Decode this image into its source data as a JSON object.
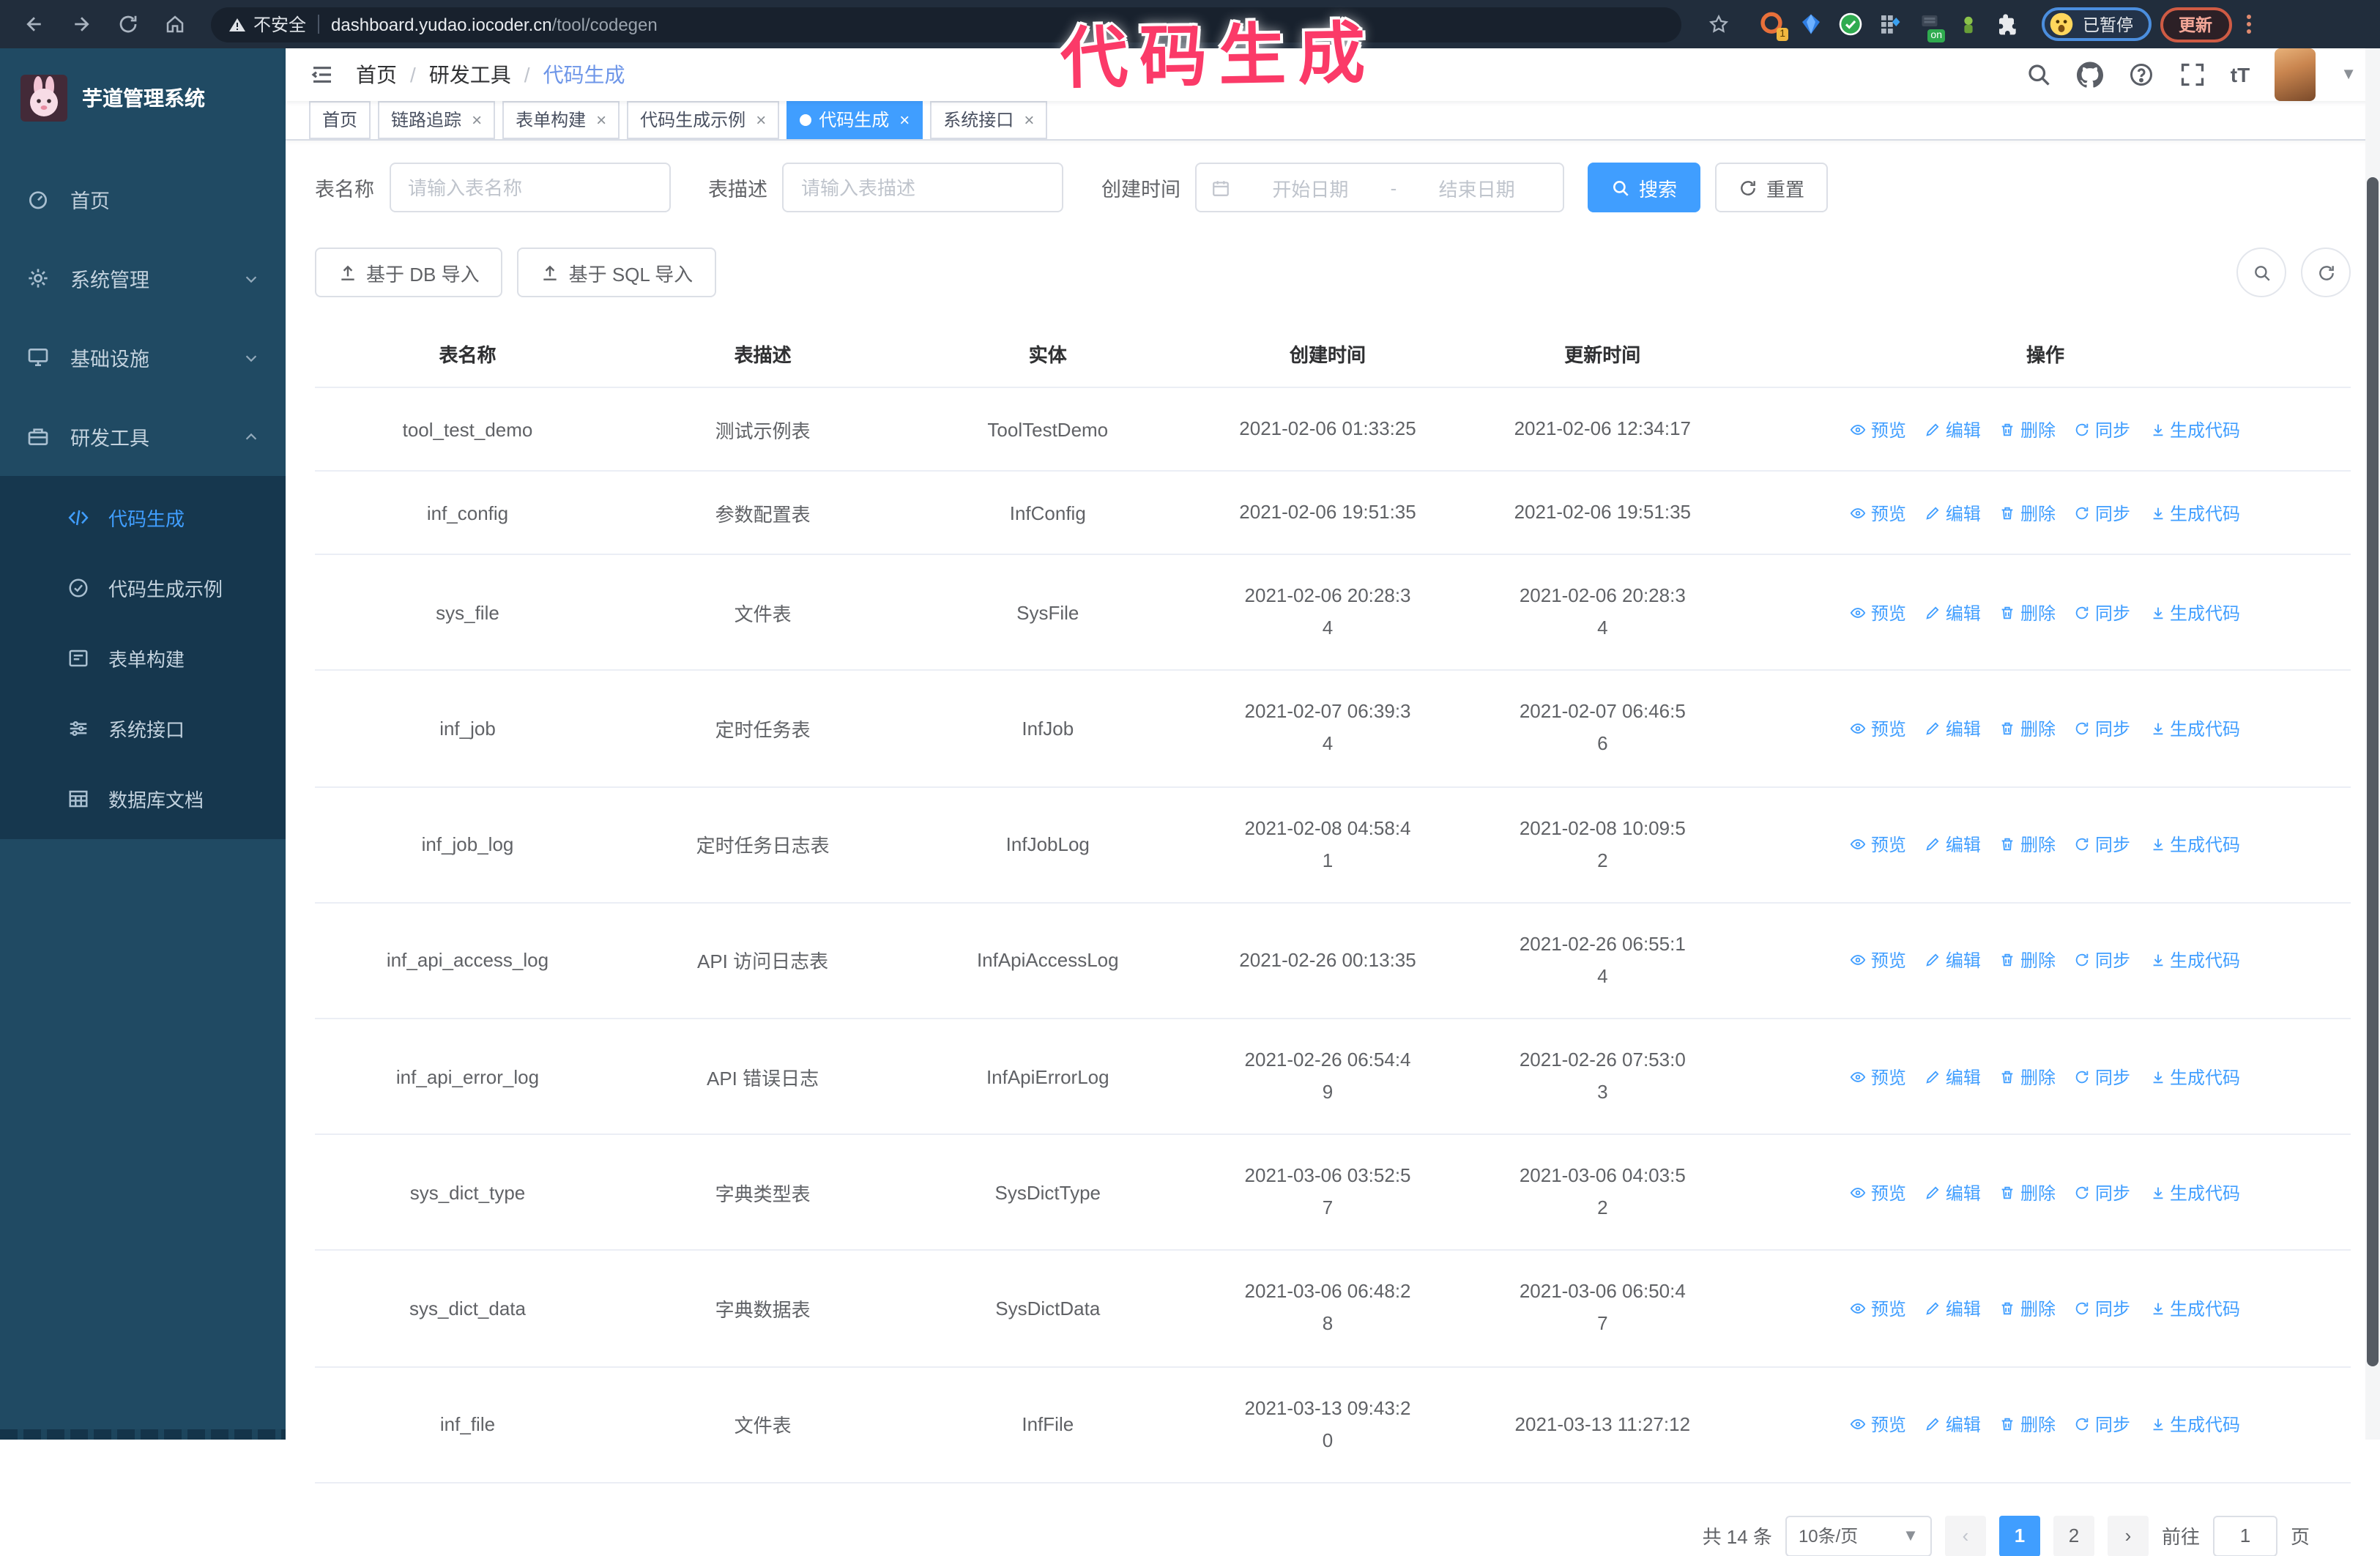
{
  "overlay": {
    "annotation": "代码生成",
    "color": "#fb3a68"
  },
  "browser": {
    "security_label": "不安全",
    "url_host": "dashboard.yudao.iocoder.cn",
    "url_path": "/tool/codegen",
    "paused_badge": "已暂停",
    "update_button": "更新",
    "extensions": [
      "orange-circle-extension",
      "blue-gem-extension",
      "green-check-extension",
      "grid-extension",
      "on-badge-extension",
      "green-bot-extension",
      "puzzle-extensions-menu"
    ]
  },
  "sidebar": {
    "title": "芋道管理系统",
    "items": [
      {
        "label": "首页"
      },
      {
        "label": "系统管理",
        "chevron": "down"
      },
      {
        "label": "基础设施",
        "chevron": "down"
      },
      {
        "label": "研发工具",
        "chevron": "up",
        "expanded": true,
        "children": [
          {
            "label": "代码生成",
            "active": true
          },
          {
            "label": "代码生成示例"
          },
          {
            "label": "表单构建"
          },
          {
            "label": "系统接口"
          },
          {
            "label": "数据库文档"
          }
        ]
      }
    ]
  },
  "header": {
    "breadcrumb": [
      "首页",
      "研发工具",
      "代码生成"
    ]
  },
  "tabs": [
    {
      "label": "首页",
      "closable": false,
      "active": false
    },
    {
      "label": "链路追踪",
      "closable": true,
      "active": false
    },
    {
      "label": "表单构建",
      "closable": true,
      "active": false
    },
    {
      "label": "代码生成示例",
      "closable": true,
      "active": false
    },
    {
      "label": "代码生成",
      "closable": true,
      "active": true
    },
    {
      "label": "系统接口",
      "closable": true,
      "active": false
    }
  ],
  "filters": {
    "name_label": "表名称",
    "name_placeholder": "请输入表名称",
    "desc_label": "表描述",
    "desc_placeholder": "请输入表描述",
    "time_label": "创建时间",
    "start_placeholder": "开始日期",
    "range_separator": "-",
    "end_placeholder": "结束日期",
    "search_label": "搜索",
    "reset_label": "重置"
  },
  "toolbar": {
    "import_db_label": "基于 DB 导入",
    "import_sql_label": "基于 SQL 导入"
  },
  "table": {
    "columns": [
      "表名称",
      "表描述",
      "实体",
      "创建时间",
      "更新时间",
      "操作"
    ],
    "row_actions": [
      "预览",
      "编辑",
      "删除",
      "同步",
      "生成代码"
    ],
    "rows": [
      {
        "name": "tool_test_demo",
        "desc": "测试示例表",
        "entity": "ToolTestDemo",
        "created": "2021-02-06 01:33:25",
        "updated": "2021-02-06 12:34:17"
      },
      {
        "name": "inf_config",
        "desc": "参数配置表",
        "entity": "InfConfig",
        "created": "2021-02-06 19:51:35",
        "updated": "2021-02-06 19:51:35"
      },
      {
        "name": "sys_file",
        "desc": "文件表",
        "entity": "SysFile",
        "created": "2021-02-06 20:28:3\n4",
        "updated": "2021-02-06 20:28:3\n4"
      },
      {
        "name": "inf_job",
        "desc": "定时任务表",
        "entity": "InfJob",
        "created": "2021-02-07 06:39:3\n4",
        "updated": "2021-02-07 06:46:5\n6"
      },
      {
        "name": "inf_job_log",
        "desc": "定时任务日志表",
        "entity": "InfJobLog",
        "created": "2021-02-08 04:58:4\n1",
        "updated": "2021-02-08 10:09:5\n2"
      },
      {
        "name": "inf_api_access_log",
        "desc": "API 访问日志表",
        "entity": "InfApiAccessLog",
        "created": "2021-02-26 00:13:35",
        "updated": "2021-02-26 06:55:1\n4"
      },
      {
        "name": "inf_api_error_log",
        "desc": "API 错误日志",
        "entity": "InfApiErrorLog",
        "created": "2021-02-26 06:54:4\n9",
        "updated": "2021-02-26 07:53:0\n3"
      },
      {
        "name": "sys_dict_type",
        "desc": "字典类型表",
        "entity": "SysDictType",
        "created": "2021-03-06 03:52:5\n7",
        "updated": "2021-03-06 04:03:5\n2"
      },
      {
        "name": "sys_dict_data",
        "desc": "字典数据表",
        "entity": "SysDictData",
        "created": "2021-03-06 06:48:2\n8",
        "updated": "2021-03-06 06:50:4\n7"
      },
      {
        "name": "inf_file",
        "desc": "文件表",
        "entity": "InfFile",
        "created": "2021-03-13 09:43:2\n0",
        "updated": "2021-03-13 11:27:12"
      }
    ]
  },
  "pagination": {
    "total": "共 14 条",
    "page_size": "10条/页",
    "pages": [
      "1",
      "2"
    ],
    "active_page": "1",
    "goto_label": "前往",
    "goto_value": "1",
    "page_suffix": "页"
  }
}
